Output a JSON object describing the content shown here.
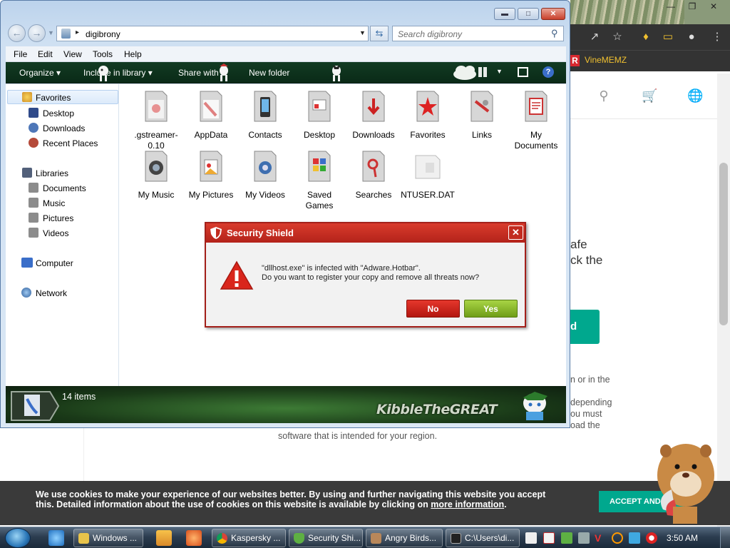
{
  "browser": {
    "bookmark": "VineMEMZ",
    "site_fragments": {
      "line1": "afe",
      "line2": "ck the",
      "button": "d",
      "note1": "n or in the",
      "note2": "depending",
      "note3": "ou must",
      "note4": "oad the"
    },
    "region_line": "software that is intended for your region.",
    "cookie": {
      "text": "We use cookies to make your experience of our websites better. By using and further navigating this website you accept this. Detailed information about the use of cookies on this website is available by clicking on",
      "link": "more information",
      "end": ".",
      "accept": "ACCEPT AND CL..."
    }
  },
  "explorer": {
    "address": "digibrony",
    "search_placeholder": "Search digibrony",
    "menu": [
      "File",
      "Edit",
      "View",
      "Tools",
      "Help"
    ],
    "commands": [
      "Organize ▾",
      "Include in library ▾",
      "Share with ▾",
      "New folder"
    ],
    "nav": {
      "favorites": "Favorites",
      "desktop": "Desktop",
      "downloads": "Downloads",
      "recent": "Recent Places",
      "libraries": "Libraries",
      "documents": "Documents",
      "music": "Music",
      "pictures": "Pictures",
      "videos": "Videos",
      "computer": "Computer",
      "network": "Network"
    },
    "files": [
      ".gstreamer-0.10",
      "AppData",
      "Contacts",
      "Desktop",
      "Downloads",
      "Favorites",
      "Links",
      "My Documents",
      "My Music",
      "My Pictures",
      "My Videos",
      "Saved Games",
      "Searches",
      "NTUSER.DAT"
    ],
    "status_count": "14 items",
    "status_brand": "KibbleTheGREAT"
  },
  "dialog": {
    "title": "Security Shield",
    "message_line1": "\"dllhost.exe\" is infected with \"Adware.Hotbar\".",
    "message_line2": "Do you want to register your copy and remove all threats now?",
    "no": "No",
    "yes": "Yes"
  },
  "taskbar": {
    "tasks": [
      "Windows ...",
      "Kaspersky ...",
      "Security Shi...",
      "Angry Birds...",
      "C:\\Users\\di..."
    ],
    "clock": "3:50 AM"
  },
  "colors": {
    "dialog_red": "#c22b1f",
    "yes_green": "#8bbb2a",
    "accent_teal": "#00a88e"
  }
}
